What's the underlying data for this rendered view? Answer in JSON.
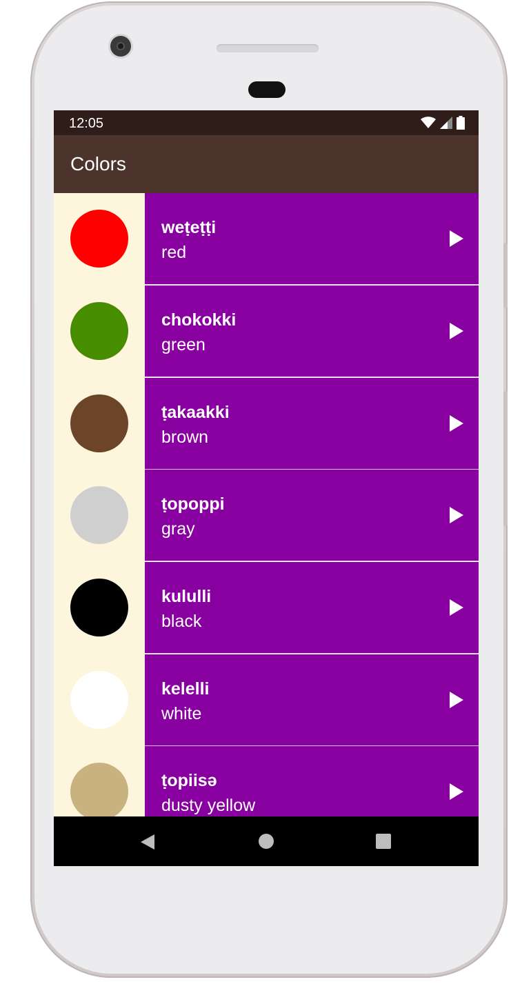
{
  "status_bar": {
    "time": "12:05",
    "icons": [
      "wifi-icon",
      "cellular-signal-icon",
      "battery-icon"
    ]
  },
  "app_bar": {
    "title": "Colors"
  },
  "colors": {
    "header_bg": "#4c332c",
    "status_bg": "#2f1d1a",
    "row_bg": "#8800a0",
    "swatch_cell_bg": "#fdf6dc",
    "divider": "#e6c9ee"
  },
  "list": {
    "items": [
      {
        "word": "weṭeṭṭi",
        "translation": "red",
        "swatch": "#ff0000",
        "icon": "play-icon"
      },
      {
        "word": "chokokki",
        "translation": "green",
        "swatch": "#478d00",
        "icon": "play-icon"
      },
      {
        "word": "ṭakaakki",
        "translation": "brown",
        "swatch": "#6c4428",
        "icon": "play-icon"
      },
      {
        "word": "ṭopoppi",
        "translation": "gray",
        "swatch": "#cfcfcf",
        "icon": "play-icon"
      },
      {
        "word": "kululli",
        "translation": "black",
        "swatch": "#000000",
        "icon": "play-icon"
      },
      {
        "word": "kelelli",
        "translation": "white",
        "swatch": "#ffffff",
        "icon": "play-icon"
      },
      {
        "word": "ṭopiisə",
        "translation": "dusty yellow",
        "swatch": "#c8b280",
        "icon": "play-icon"
      }
    ]
  },
  "nav_bar": {
    "icons": [
      "back-icon",
      "home-icon",
      "recents-icon"
    ]
  }
}
